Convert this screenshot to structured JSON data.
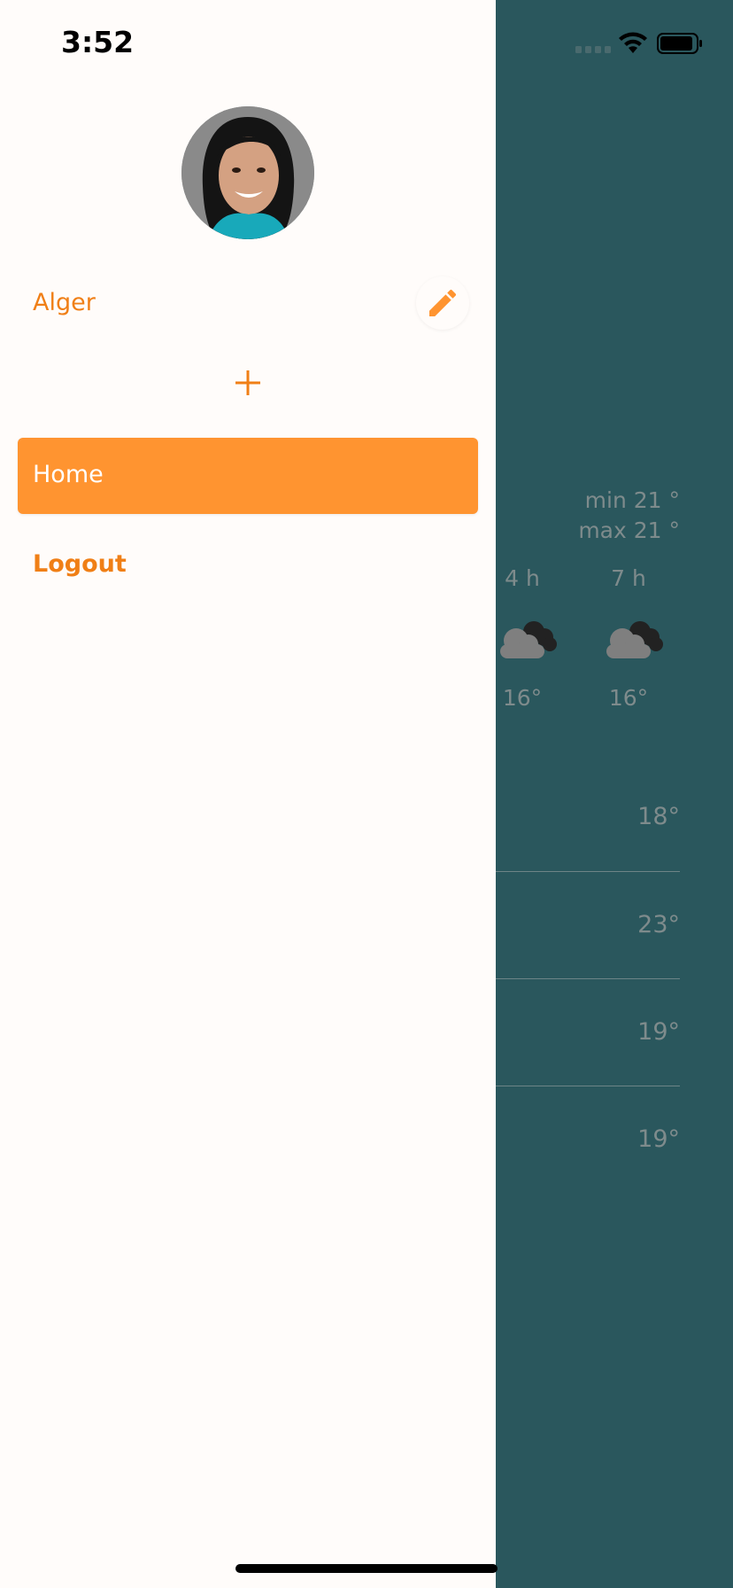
{
  "status_bar": {
    "time": "3:52"
  },
  "drawer": {
    "user_name": "Alger",
    "menu": [
      {
        "label": "Home",
        "selected": true
      },
      {
        "label": "Logout",
        "selected": false
      }
    ]
  },
  "background_weather": {
    "min": "min 21 °",
    "max": "max 21 °",
    "hours": [
      {
        "label": "4 h",
        "temp": "16°",
        "icon": "cloud-icon"
      },
      {
        "label": "7 h",
        "temp": "16°",
        "icon": "cloud-icon"
      }
    ],
    "days": [
      {
        "temp": "18°"
      },
      {
        "temp": "23°"
      },
      {
        "temp": "19°"
      },
      {
        "temp": "19°"
      }
    ]
  },
  "colors": {
    "accent": "#FF9430",
    "accent_text": "#F07F16",
    "drawer_bg": "#FFFCFA",
    "weather_bg": "#2A575D"
  }
}
